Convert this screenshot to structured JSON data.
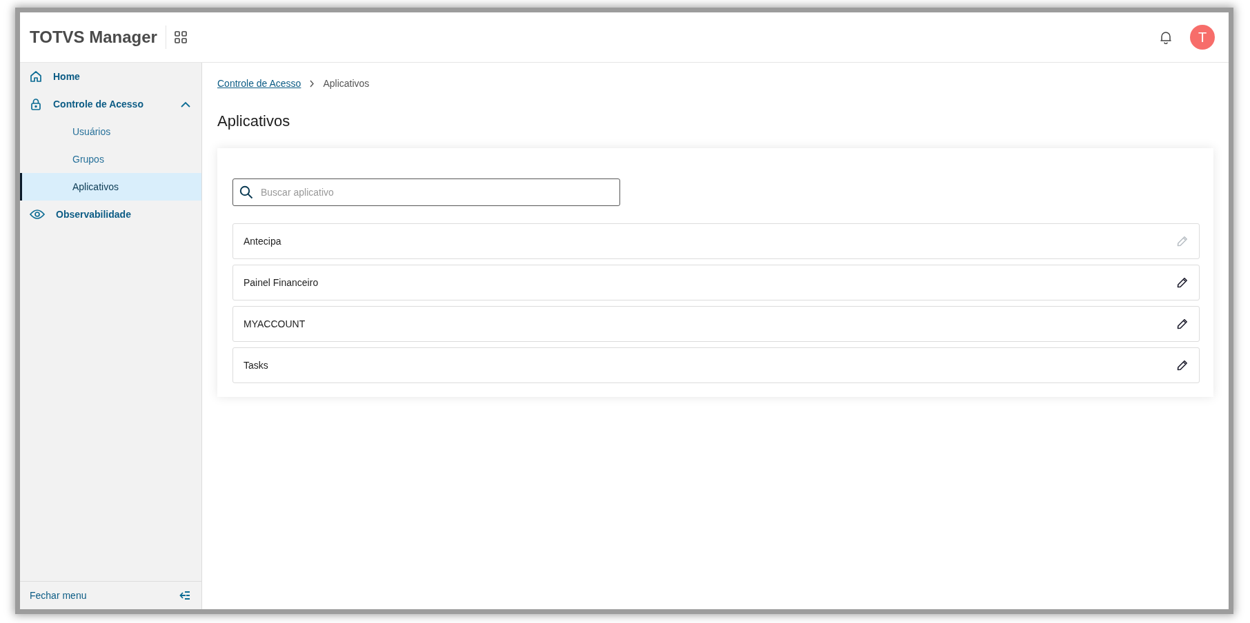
{
  "header": {
    "title": "TOTVS Manager",
    "avatar": "T"
  },
  "sidebar": {
    "items": [
      {
        "label": "Home",
        "selected": false
      },
      {
        "label": "Controle de Acesso",
        "selected": false,
        "expanded": true,
        "children": [
          {
            "label": "Usuários",
            "selected": false
          },
          {
            "label": "Grupos",
            "selected": false
          },
          {
            "label": "Aplicativos",
            "selected": true
          }
        ]
      },
      {
        "label": "Observabilidade",
        "selected": false
      }
    ],
    "footer": "Fechar menu"
  },
  "breadcrumb": [
    {
      "label": "Controle de Acesso",
      "kind": "link"
    },
    {
      "label": "Aplicativos",
      "kind": "current"
    }
  ],
  "page_title": "Aplicativos",
  "search": {
    "placeholder": "Buscar aplicativo"
  },
  "apps": [
    {
      "name": "Antecipa",
      "disabled": true
    },
    {
      "name": "Painel Financeiro",
      "disabled": false
    },
    {
      "name": "MYACCOUNT",
      "disabled": false
    },
    {
      "name": "Tasks",
      "disabled": false
    }
  ]
}
